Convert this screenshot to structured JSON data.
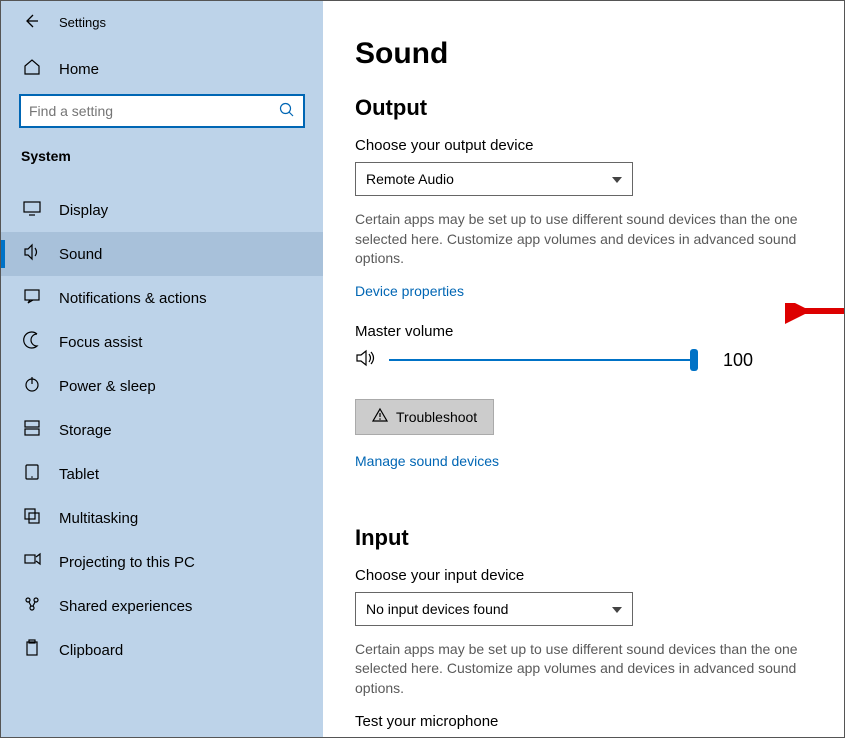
{
  "app_title": "Settings",
  "home_label": "Home",
  "search_placeholder": "Find a setting",
  "sidebar_section": "System",
  "nav": [
    {
      "icon": "display",
      "label": "Display"
    },
    {
      "icon": "sound",
      "label": "Sound"
    },
    {
      "icon": "notifications",
      "label": "Notifications & actions"
    },
    {
      "icon": "focus",
      "label": "Focus assist"
    },
    {
      "icon": "power",
      "label": "Power & sleep"
    },
    {
      "icon": "storage",
      "label": "Storage"
    },
    {
      "icon": "tablet",
      "label": "Tablet"
    },
    {
      "icon": "multitask",
      "label": "Multitasking"
    },
    {
      "icon": "project",
      "label": "Projecting to this PC"
    },
    {
      "icon": "shared",
      "label": "Shared experiences"
    },
    {
      "icon": "clipboard",
      "label": "Clipboard"
    }
  ],
  "active_nav_index": 1,
  "page": {
    "title": "Sound",
    "output": {
      "heading": "Output",
      "choose_label": "Choose your output device",
      "selected": "Remote Audio",
      "desc": "Certain apps may be set up to use different sound devices than the one selected here. Customize app volumes and devices in advanced sound options.",
      "device_props_link": "Device properties",
      "master_volume_label": "Master volume",
      "master_volume_value": "100",
      "troubleshoot_label": "Troubleshoot",
      "manage_link": "Manage sound devices"
    },
    "input": {
      "heading": "Input",
      "choose_label": "Choose your input device",
      "selected": "No input devices found",
      "desc": "Certain apps may be set up to use different sound devices than the one selected here. Customize app volumes and devices in advanced sound options.",
      "test_label": "Test your microphone"
    }
  }
}
